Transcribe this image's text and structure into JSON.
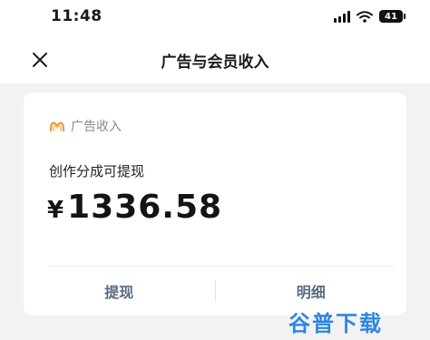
{
  "status_bar": {
    "time": "11:48",
    "battery": "41",
    "icons": [
      "signal-icon",
      "wifi-icon",
      "battery-icon"
    ]
  },
  "nav": {
    "title": "广告与会员收入",
    "close_icon": "close-icon"
  },
  "card": {
    "brand_label": "广告收入",
    "brand_icon": "brand-logo-icon",
    "brand_color": "#e9a23b",
    "earnings_label": "创作分成可提现",
    "currency": "¥",
    "amount": "1336.58",
    "actions": {
      "withdraw": "提现",
      "details": "明细"
    },
    "action_color": "#5b6a85"
  },
  "watermark": {
    "text": "谷普下载",
    "color": "#2f86de"
  }
}
